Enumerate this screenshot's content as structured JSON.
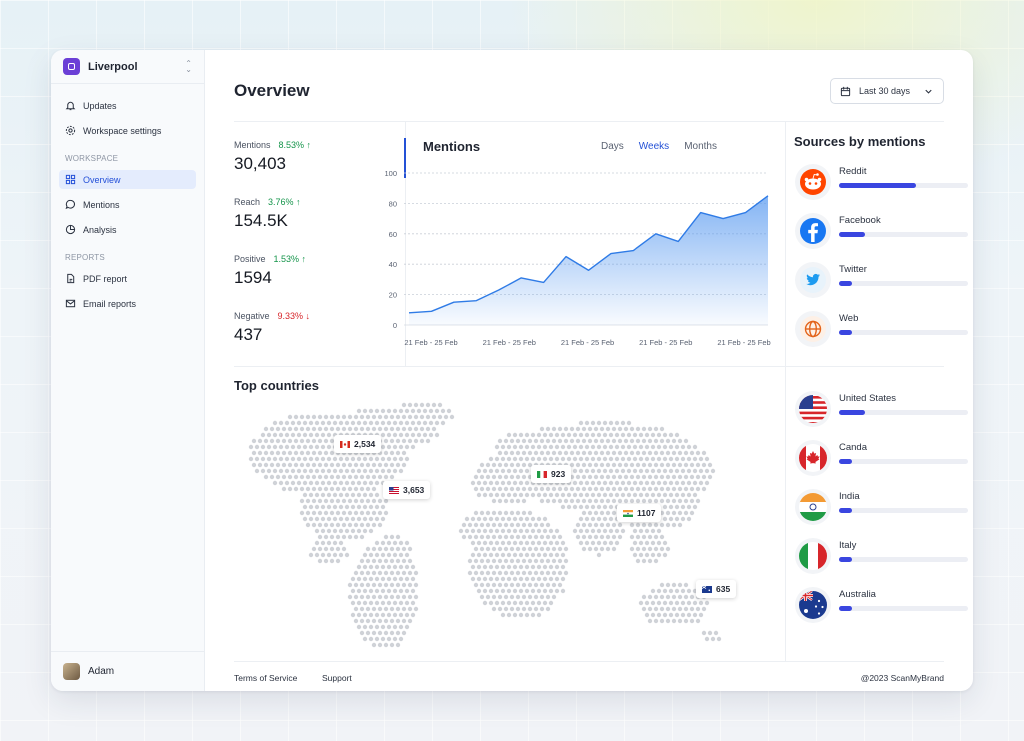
{
  "workspace": {
    "name": "Liverpool"
  },
  "nav": {
    "top_items": [
      {
        "label": "Updates",
        "icon": "bell-icon"
      },
      {
        "label": "Workspace settings",
        "icon": "gear-icon"
      }
    ],
    "workspace_section": "WORKSPACE",
    "workspace_items": [
      {
        "label": "Overview",
        "icon": "grid-icon",
        "active": true
      },
      {
        "label": "Mentions",
        "icon": "chat-icon"
      },
      {
        "label": "Analysis",
        "icon": "pie-icon"
      }
    ],
    "reports_section": "REPORTS",
    "report_items": [
      {
        "label": "PDF report",
        "icon": "file-icon"
      },
      {
        "label": "Email reports",
        "icon": "mail-icon"
      }
    ]
  },
  "user": {
    "name": "Adam"
  },
  "header": {
    "title": "Overview",
    "date_range": "Last 30 days"
  },
  "stats": [
    {
      "label": "Mentions",
      "change": "8.53% ↑",
      "direction": "up",
      "value": "30,403"
    },
    {
      "label": "Reach",
      "change": "3.76% ↑",
      "direction": "up",
      "value": "154.5K"
    },
    {
      "label": "Positive",
      "change": "1.53% ↑",
      "direction": "up",
      "value": "1594"
    },
    {
      "label": "Negative",
      "change": "9.33% ↓",
      "direction": "down",
      "value": "437"
    }
  ],
  "mentions_chart": {
    "title": "Mentions",
    "tabs": [
      "Days",
      "Weeks",
      "Months"
    ],
    "active_tab": "Weeks"
  },
  "chart_data": {
    "type": "area",
    "title": "Mentions",
    "y_ticks": [
      0,
      20,
      40,
      60,
      80,
      100
    ],
    "ylim": [
      0,
      100
    ],
    "x_tick_labels": [
      "21 Feb - 25 Feb",
      "21 Feb - 25 Feb",
      "21 Feb - 25 Feb",
      "21 Feb - 25 Feb",
      "21 Feb - 25 Feb"
    ],
    "values": [
      8,
      9,
      15,
      16,
      23,
      31,
      28,
      45,
      36,
      47,
      49,
      60,
      55,
      74,
      70,
      74,
      85
    ],
    "grid": true,
    "color": "#2f7be6"
  },
  "sources": {
    "title": "Sources by mentions",
    "items": [
      {
        "name": "Reddit",
        "percent": 60,
        "percent_label": "60%",
        "icon": "reddit-icon"
      },
      {
        "name": "Facebook",
        "percent": 20,
        "percent_label": "20%",
        "icon": "facebook-icon"
      },
      {
        "name": "Twitter",
        "percent": 10,
        "percent_label": "10%",
        "icon": "twitter-icon"
      },
      {
        "name": "Web",
        "percent": 10,
        "percent_label": "10%",
        "icon": "globe-icon"
      }
    ]
  },
  "countries": {
    "title": "Top countries",
    "items": [
      {
        "name": "United States",
        "percent": 20,
        "percent_label": "20%",
        "icon": "us-flag-icon"
      },
      {
        "name": "Canda",
        "percent": 10,
        "percent_label": "10%",
        "icon": "canada-flag-icon"
      },
      {
        "name": "India",
        "percent": 10,
        "percent_label": "10%",
        "icon": "india-flag-icon"
      },
      {
        "name": "Italy",
        "percent": 10,
        "percent_label": "10%",
        "icon": "italy-flag-icon"
      },
      {
        "name": "Australia",
        "percent": 10,
        "percent_label": "10%",
        "icon": "australia-flag-icon"
      }
    ],
    "map_pins": [
      {
        "country": "Canada",
        "value": "2,534"
      },
      {
        "country": "United States",
        "value": "3,653"
      },
      {
        "country": "Italy",
        "value": "923"
      },
      {
        "country": "India",
        "value": "1107"
      },
      {
        "country": "Australia",
        "value": "635"
      }
    ]
  },
  "footer": {
    "terms": "Terms of Service",
    "support": "Support",
    "copyright": "@2023 ScanMyBrand"
  }
}
